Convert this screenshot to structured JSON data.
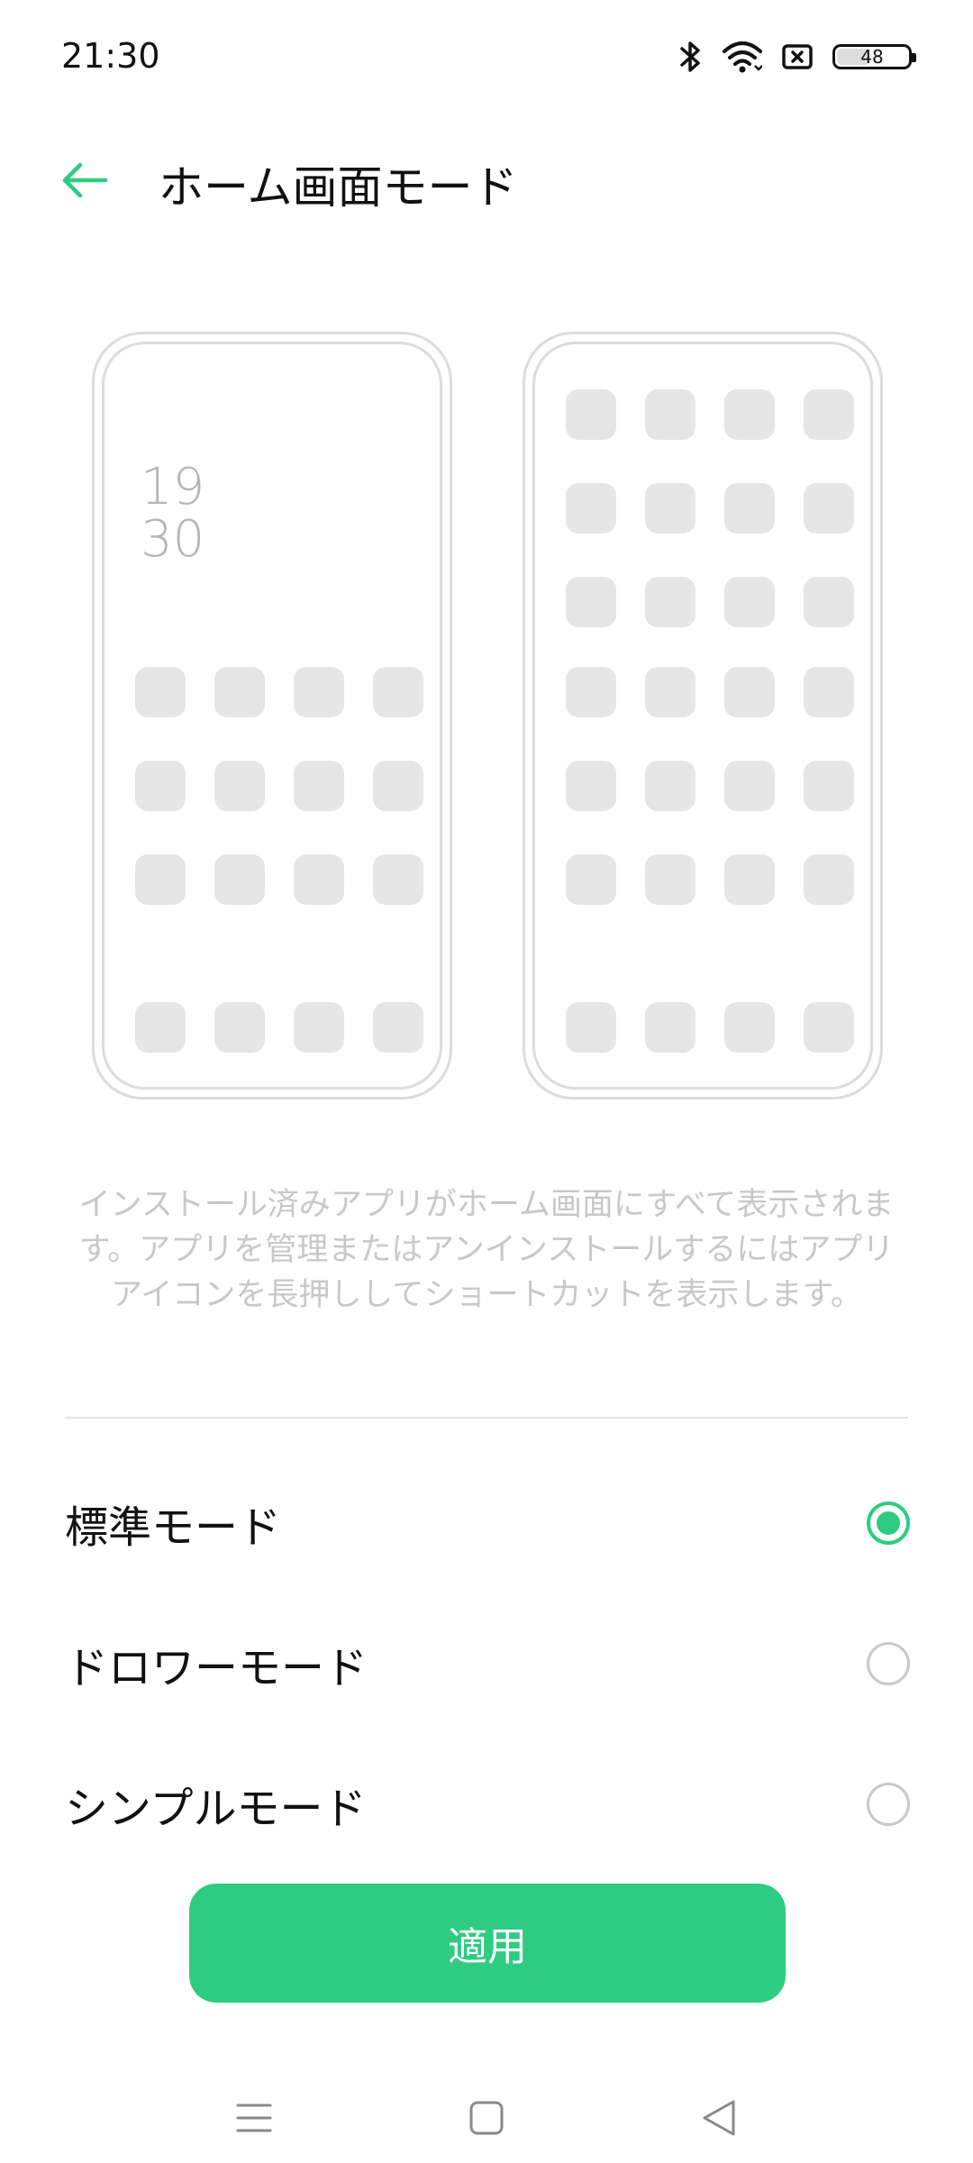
{
  "status": {
    "time": "21:30",
    "battery": "48",
    "battery_fraction": 0.48,
    "icons": [
      "bluetooth-icon",
      "wifi-icon",
      "sim-none-icon",
      "battery-icon"
    ]
  },
  "header": {
    "title": "ホーム画面モード",
    "back_icon": "arrow-left-icon"
  },
  "preview": {
    "clock_hour": "19",
    "clock_minute": "30"
  },
  "description": "インストール済みアプリがホーム画面にすべて表示されます。アプリを管理またはアンインストールするにはアプリアイコンを長押ししてショートカットを表示します。",
  "options": [
    {
      "label": "標準モード",
      "selected": true
    },
    {
      "label": "ドロワーモード",
      "selected": false
    },
    {
      "label": "シンプルモード",
      "selected": false
    }
  ],
  "apply_label": "適用",
  "colors": {
    "accent": "#2ECC80",
    "preview_outline": "#DCDCDC",
    "placeholder_icon": "#E6E6E6",
    "description_text": "#C8C8C8"
  },
  "navbar": [
    "menu-icon",
    "home-square-icon",
    "back-triangle-icon"
  ]
}
